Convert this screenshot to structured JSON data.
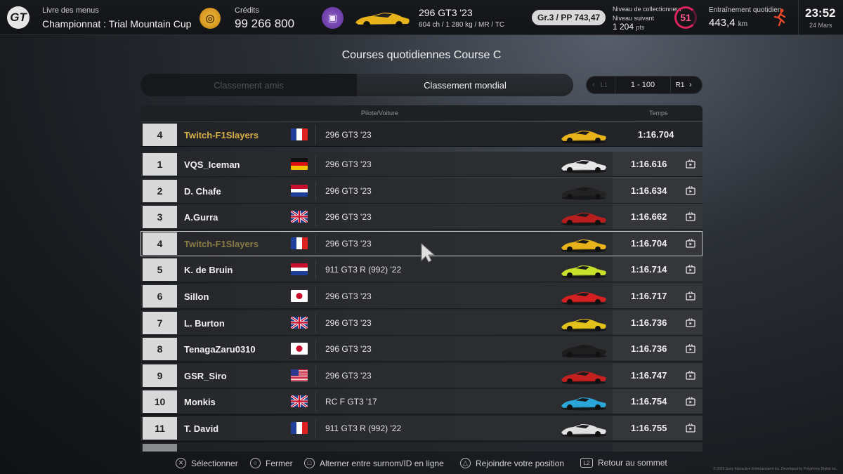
{
  "topbar": {
    "menu_label": "Livre des menus",
    "menu_title": "Championnat : Trial Mountain Cup",
    "credits_label": "Crédits",
    "credits_value": "99 266 800",
    "car_name": "296 GT3 '23",
    "car_spec": "604 ch / 1 280 kg / MR / TC",
    "pp_badge": "Gr.3 / PP 743,47",
    "collector_label": "Niveau de collectionneur",
    "collector_next": "Niveau suivant",
    "collector_points": "1 204",
    "collector_points_unit": "pts",
    "collector_level": "51",
    "daily_label": "Entraînement quotidien",
    "daily_value": "443,4",
    "daily_unit": "km",
    "clock": "23:52",
    "date": "24 Mars",
    "colors": {
      "coin": "#d89a22",
      "garage": "#6c3fa8",
      "level": "#e0235f",
      "runner": "#e8472a"
    }
  },
  "page": {
    "title": "Courses quotidiennes Course C",
    "tabs": [
      {
        "label": "Classement amis",
        "active": false
      },
      {
        "label": "Classement mondial",
        "active": true
      }
    ],
    "pager": {
      "l1": "L1",
      "range": "1 - 100",
      "r1": "R1"
    }
  },
  "table": {
    "header_pilot": "Pilote/Voiture",
    "header_time": "Temps",
    "my_entry": {
      "rank": "4",
      "name": "Twitch-F1Slayers",
      "flag": "fr",
      "car": "296 GT3 '23",
      "time": "1:16.704",
      "car_color": "#e8b21a"
    },
    "rows": [
      {
        "rank": "1",
        "name": "VQS_Iceman",
        "flag": "de",
        "car": "296 GT3 '23",
        "time": "1:16.616",
        "car_color": "#e6e6e6"
      },
      {
        "rank": "2",
        "name": "D. Chafe",
        "flag": "nl",
        "car": "296 GT3 '23",
        "time": "1:16.634",
        "car_color": "#222222"
      },
      {
        "rank": "3",
        "name": "A.Gurra",
        "flag": "gb",
        "car": "296 GT3 '23",
        "time": "1:16.662",
        "car_color": "#b81e1e"
      },
      {
        "rank": "4",
        "name": "Twitch-F1Slayers",
        "flag": "fr",
        "car": "296 GT3 '23",
        "time": "1:16.704",
        "car_color": "#e8b21a"
      },
      {
        "rank": "5",
        "name": "K. de Bruin",
        "flag": "nl",
        "car": "911 GT3 R (992) '22",
        "time": "1:16.714",
        "car_color": "#c8e02a"
      },
      {
        "rank": "6",
        "name": "Sillon",
        "flag": "jp",
        "car": "296 GT3 '23",
        "time": "1:16.717",
        "car_color": "#d42020"
      },
      {
        "rank": "7",
        "name": "L. Burton",
        "flag": "gb",
        "car": "296 GT3 '23",
        "time": "1:16.736",
        "car_color": "#e2c21a"
      },
      {
        "rank": "8",
        "name": "TenagaZaru0310",
        "flag": "jp",
        "car": "296 GT3 '23",
        "time": "1:16.736",
        "car_color": "#1e1e1e"
      },
      {
        "rank": "9",
        "name": "GSR_Siro",
        "flag": "us",
        "car": "296 GT3 '23",
        "time": "1:16.747",
        "car_color": "#c42020"
      },
      {
        "rank": "10",
        "name": "Monkis",
        "flag": "gb",
        "car": "RC F GT3 '17",
        "time": "1:16.754",
        "car_color": "#2aa7d8"
      },
      {
        "rank": "11",
        "name": "T. David",
        "flag": "fr",
        "car": "911 GT3 R (992) '22",
        "time": "1:16.755",
        "car_color": "#e0e0e0"
      }
    ]
  },
  "footer": {
    "select": "Sélectionner",
    "close": "Fermer",
    "toggle": "Alterner entre surnom/ID en ligne",
    "join": "Rejoindre votre position",
    "top": "Retour au sommet",
    "l2": "L2",
    "copyright": "© 2025 Sony Interactive Entertainment Inc. Developed by Polyphony Digital Inc."
  }
}
